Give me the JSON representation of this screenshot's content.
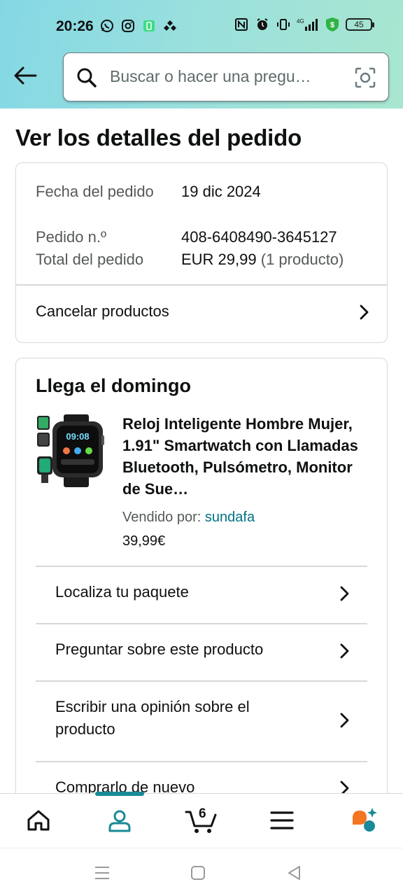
{
  "status_bar": {
    "time": "20:26",
    "battery": "45",
    "network": "4G"
  },
  "search": {
    "placeholder": "Buscar o hacer una pregu…"
  },
  "page": {
    "title": "Ver los detalles del pedido"
  },
  "order_summary": {
    "date_label": "Fecha del pedido",
    "date_value": "19 dic 2024",
    "number_label": "Pedido n.º",
    "number_value": "408-6408490-3645127",
    "total_label": "Total del pedido",
    "total_value": "EUR 29,99",
    "total_count": "(1 producto)",
    "cancel_label": "Cancelar productos"
  },
  "shipment": {
    "arrival": "Llega el domingo",
    "product_title": "Reloj Inteligente Hombre Mujer, 1.91\" Smartwatch con Llamadas Bluetooth, Pulsómetro, Monitor de Sue…",
    "sold_by_label": "Vendido por:",
    "seller": "sundafa",
    "price": "39,99€",
    "watch_screen_time": "09:08",
    "actions": [
      {
        "label": "Localiza tu paquete"
      },
      {
        "label": "Preguntar sobre este producto"
      },
      {
        "label": "Escribir una opinión sobre el producto"
      },
      {
        "label": "Comprarlo de nuevo"
      }
    ]
  },
  "bottom_nav": {
    "cart_count": "6",
    "items": [
      "home-icon",
      "account-icon",
      "cart-icon",
      "menu-icon",
      "rufus-icon"
    ],
    "active": "account-icon"
  },
  "colors": {
    "link": "#007185",
    "accent": "#1a8a98",
    "text": "#0F1111",
    "muted": "#565959",
    "border": "#d5d9d9"
  }
}
